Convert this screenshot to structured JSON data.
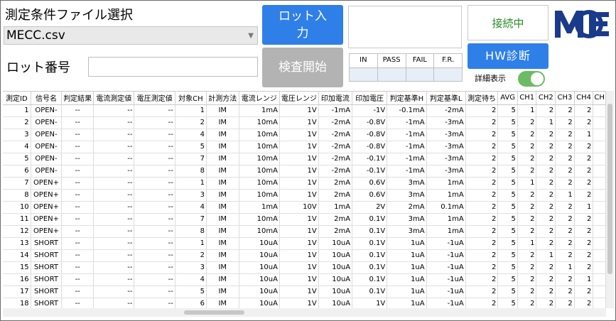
{
  "condition": {
    "label": "測定条件ファイル選択",
    "selected_file": "MECC.csv"
  },
  "lot": {
    "label": "ロット番号",
    "value": ""
  },
  "buttons": {
    "lot_input": "ロット入力",
    "start_inspection": "検査開始",
    "hw_diagnose": "HW診断"
  },
  "status": {
    "connection": "接続中",
    "detail_label": "詳細表示",
    "detail_on": true
  },
  "stats": {
    "headers": [
      "IN",
      "PASS",
      "FAIL",
      "F.R."
    ],
    "values": [
      "",
      "",
      "",
      ""
    ]
  },
  "logo": {
    "text": "MCE"
  },
  "colors": {
    "accent": "#2f7fe8",
    "connected": "#2a8a2a",
    "disabled": "#b3b3b3",
    "toggle_on": "#6dbb63",
    "logo": "#1a3a8a"
  },
  "table": {
    "columns": [
      "測定ID",
      "信号名",
      "判定結果",
      "電流測定値",
      "電圧測定値",
      "対象CH",
      "計測方法",
      "電流レンジ",
      "電圧レンジ",
      "印加電流",
      "印加電圧",
      "判定基準H",
      "判定基準L",
      "測定待ち",
      "AVG",
      "CH1",
      "CH2",
      "CH3",
      "CH4",
      "CH"
    ],
    "rows": [
      [
        "1",
        "OPEN-",
        "--",
        "--",
        "--",
        "1",
        "IM",
        "1mA",
        "1V",
        "-1mA",
        "-1V",
        "-0.1mA",
        "-2mA",
        "2",
        "5",
        "1",
        "2",
        "2",
        "2",
        ""
      ],
      [
        "2",
        "OPEN-",
        "--",
        "--",
        "--",
        "2",
        "IM",
        "10mA",
        "1V",
        "-2mA",
        "-0.8V",
        "-1mA",
        "-3mA",
        "2",
        "5",
        "2",
        "1",
        "2",
        "2",
        ""
      ],
      [
        "3",
        "OPEN-",
        "--",
        "--",
        "--",
        "4",
        "IM",
        "10mA",
        "1V",
        "-2mA",
        "-0.8V",
        "-1mA",
        "-3mA",
        "2",
        "5",
        "2",
        "2",
        "2",
        "1",
        ""
      ],
      [
        "4",
        "OPEN-",
        "--",
        "--",
        "--",
        "5",
        "IM",
        "10mA",
        "1V",
        "-2mA",
        "-0.8V",
        "-1mA",
        "-3mA",
        "2",
        "5",
        "2",
        "2",
        "2",
        "2",
        ""
      ],
      [
        "5",
        "OPEN-",
        "--",
        "--",
        "--",
        "7",
        "IM",
        "10mA",
        "1V",
        "-2mA",
        "-0.1V",
        "-1mA",
        "-3mA",
        "2",
        "5",
        "2",
        "2",
        "2",
        "2",
        ""
      ],
      [
        "6",
        "OPEN-",
        "--",
        "--",
        "--",
        "8",
        "IM",
        "10mA",
        "1V",
        "-2mA",
        "-0.1V",
        "-1mA",
        "-3mA",
        "2",
        "5",
        "2",
        "2",
        "2",
        "2",
        ""
      ],
      [
        "7",
        "OPEN+",
        "--",
        "--",
        "--",
        "1",
        "IM",
        "10mA",
        "1V",
        "2mA",
        "0.6V",
        "3mA",
        "1mA",
        "2",
        "5",
        "1",
        "2",
        "2",
        "2",
        ""
      ],
      [
        "8",
        "OPEN+",
        "--",
        "--",
        "--",
        "3",
        "IM",
        "10mA",
        "1V",
        "2mA",
        "0.6V",
        "3mA",
        "1mA",
        "2",
        "5",
        "2",
        "2",
        "1",
        "2",
        ""
      ],
      [
        "10",
        "OPEN+",
        "--",
        "--",
        "--",
        "4",
        "IM",
        "1mA",
        "10V",
        "1mA",
        "2V",
        "2mA",
        "0.1mA",
        "2",
        "5",
        "2",
        "2",
        "2",
        "1",
        ""
      ],
      [
        "11",
        "OPEN+",
        "--",
        "--",
        "--",
        "7",
        "IM",
        "10mA",
        "1V",
        "2mA",
        "0.1V",
        "3mA",
        "1mA",
        "2",
        "5",
        "2",
        "2",
        "2",
        "2",
        ""
      ],
      [
        "12",
        "OPEN+",
        "--",
        "--",
        "--",
        "8",
        "IM",
        "10mA",
        "1V",
        "2mA",
        "0.1V",
        "3mA",
        "1mA",
        "2",
        "5",
        "2",
        "2",
        "2",
        "2",
        ""
      ],
      [
        "13",
        "SHORT",
        "--",
        "--",
        "--",
        "1",
        "IM",
        "10uA",
        "1V",
        "10uA",
        "0.1V",
        "1uA",
        "-1uA",
        "2",
        "5",
        "1",
        "2",
        "2",
        "2",
        ""
      ],
      [
        "14",
        "SHORT",
        "--",
        "--",
        "--",
        "2",
        "IM",
        "10uA",
        "1V",
        "10uA",
        "0.1V",
        "1uA",
        "-1uA",
        "2",
        "5",
        "2",
        "1",
        "2",
        "2",
        ""
      ],
      [
        "15",
        "SHORT",
        "--",
        "--",
        "--",
        "3",
        "IM",
        "10uA",
        "1V",
        "10uA",
        "0.1V",
        "1uA",
        "-1uA",
        "2",
        "5",
        "2",
        "2",
        "1",
        "2",
        ""
      ],
      [
        "16",
        "SHORT",
        "--",
        "--",
        "--",
        "4",
        "IM",
        "10uA",
        "1V",
        "10uA",
        "0.1V",
        "1uA",
        "-1uA",
        "2",
        "5",
        "2",
        "2",
        "2",
        "1",
        ""
      ],
      [
        "17",
        "SHORT",
        "--",
        "--",
        "--",
        "5",
        "IM",
        "10uA",
        "1V",
        "10uA",
        "0.1V",
        "1uA",
        "-1uA",
        "2",
        "5",
        "2",
        "2",
        "2",
        "2",
        ""
      ],
      [
        "18",
        "SHORT",
        "--",
        "--",
        "--",
        "6",
        "IM",
        "10uA",
        "1V",
        "10uA",
        "1V",
        "1uA",
        "-1uA",
        "2",
        "5",
        "2",
        "2",
        "2",
        "2",
        ""
      ]
    ]
  }
}
